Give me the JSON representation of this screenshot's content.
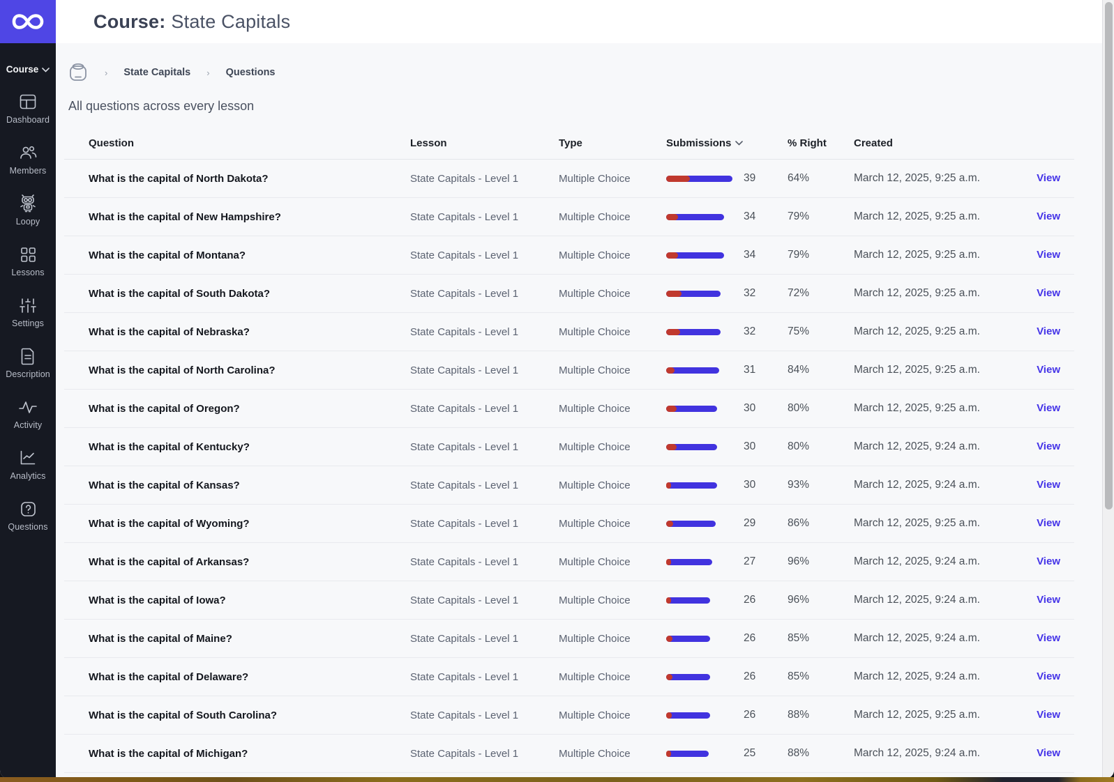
{
  "colors": {
    "accent": "#4f46e5",
    "sidebar_bg": "#161922",
    "bar_wrong_red": "#c0392e",
    "bar_right_blue": "#4133df",
    "link_blue": "#4433e8"
  },
  "sidebar": {
    "logo_icon": "infinity-icon",
    "course_switcher_label": "Course",
    "items": [
      {
        "label": "Dashboard",
        "icon": "dashboard-icon"
      },
      {
        "label": "Members",
        "icon": "members-icon"
      },
      {
        "label": "Loopy",
        "icon": "robot-icon"
      },
      {
        "label": "Lessons",
        "icon": "grid-icon"
      },
      {
        "label": "Settings",
        "icon": "sliders-icon"
      },
      {
        "label": "Description",
        "icon": "document-icon"
      },
      {
        "label": "Activity",
        "icon": "pulse-icon"
      },
      {
        "label": "Analytics",
        "icon": "chart-icon"
      },
      {
        "label": "Questions",
        "icon": "question-icon"
      }
    ]
  },
  "header": {
    "title_label": "Course:",
    "title_value": "State Capitals"
  },
  "breadcrumb": {
    "home_icon": "course-pot-icon",
    "items": [
      "State Capitals",
      "Questions"
    ]
  },
  "page": {
    "subtitle": "All questions across every lesson"
  },
  "table": {
    "columns": [
      "Question",
      "Lesson",
      "Type",
      "Submissions",
      "% Right",
      "Created"
    ],
    "sorted_column": "Submissions",
    "sort_direction": "desc",
    "action_label": "View",
    "max_submissions": 39,
    "rows": [
      {
        "question": "What is the capital of North Dakota?",
        "lesson": "State Capitals - Level 1",
        "type": "Multiple Choice",
        "submissions": 39,
        "right_pct": 64,
        "right_label": "64%",
        "created": "March 12, 2025, 9:25 a.m."
      },
      {
        "question": "What is the capital of New Hampshire?",
        "lesson": "State Capitals - Level 1",
        "type": "Multiple Choice",
        "submissions": 34,
        "right_pct": 79,
        "right_label": "79%",
        "created": "March 12, 2025, 9:25 a.m."
      },
      {
        "question": "What is the capital of Montana?",
        "lesson": "State Capitals - Level 1",
        "type": "Multiple Choice",
        "submissions": 34,
        "right_pct": 79,
        "right_label": "79%",
        "created": "March 12, 2025, 9:25 a.m."
      },
      {
        "question": "What is the capital of South Dakota?",
        "lesson": "State Capitals - Level 1",
        "type": "Multiple Choice",
        "submissions": 32,
        "right_pct": 72,
        "right_label": "72%",
        "created": "March 12, 2025, 9:25 a.m."
      },
      {
        "question": "What is the capital of Nebraska?",
        "lesson": "State Capitals - Level 1",
        "type": "Multiple Choice",
        "submissions": 32,
        "right_pct": 75,
        "right_label": "75%",
        "created": "March 12, 2025, 9:25 a.m."
      },
      {
        "question": "What is the capital of North Carolina?",
        "lesson": "State Capitals - Level 1",
        "type": "Multiple Choice",
        "submissions": 31,
        "right_pct": 84,
        "right_label": "84%",
        "created": "March 12, 2025, 9:25 a.m."
      },
      {
        "question": "What is the capital of Oregon?",
        "lesson": "State Capitals - Level 1",
        "type": "Multiple Choice",
        "submissions": 30,
        "right_pct": 80,
        "right_label": "80%",
        "created": "March 12, 2025, 9:25 a.m."
      },
      {
        "question": "What is the capital of Kentucky?",
        "lesson": "State Capitals - Level 1",
        "type": "Multiple Choice",
        "submissions": 30,
        "right_pct": 80,
        "right_label": "80%",
        "created": "March 12, 2025, 9:24 a.m."
      },
      {
        "question": "What is the capital of Kansas?",
        "lesson": "State Capitals - Level 1",
        "type": "Multiple Choice",
        "submissions": 30,
        "right_pct": 93,
        "right_label": "93%",
        "created": "March 12, 2025, 9:24 a.m."
      },
      {
        "question": "What is the capital of Wyoming?",
        "lesson": "State Capitals - Level 1",
        "type": "Multiple Choice",
        "submissions": 29,
        "right_pct": 86,
        "right_label": "86%",
        "created": "March 12, 2025, 9:25 a.m."
      },
      {
        "question": "What is the capital of Arkansas?",
        "lesson": "State Capitals - Level 1",
        "type": "Multiple Choice",
        "submissions": 27,
        "right_pct": 96,
        "right_label": "96%",
        "created": "March 12, 2025, 9:24 a.m."
      },
      {
        "question": "What is the capital of Iowa?",
        "lesson": "State Capitals - Level 1",
        "type": "Multiple Choice",
        "submissions": 26,
        "right_pct": 96,
        "right_label": "96%",
        "created": "March 12, 2025, 9:24 a.m."
      },
      {
        "question": "What is the capital of Maine?",
        "lesson": "State Capitals - Level 1",
        "type": "Multiple Choice",
        "submissions": 26,
        "right_pct": 85,
        "right_label": "85%",
        "created": "March 12, 2025, 9:24 a.m."
      },
      {
        "question": "What is the capital of Delaware?",
        "lesson": "State Capitals - Level 1",
        "type": "Multiple Choice",
        "submissions": 26,
        "right_pct": 85,
        "right_label": "85%",
        "created": "March 12, 2025, 9:24 a.m."
      },
      {
        "question": "What is the capital of South Carolina?",
        "lesson": "State Capitals - Level 1",
        "type": "Multiple Choice",
        "submissions": 26,
        "right_pct": 88,
        "right_label": "88%",
        "created": "March 12, 2025, 9:25 a.m."
      },
      {
        "question": "What is the capital of Michigan?",
        "lesson": "State Capitals - Level 1",
        "type": "Multiple Choice",
        "submissions": 25,
        "right_pct": 88,
        "right_label": "88%",
        "created": "March 12, 2025, 9:24 a.m."
      }
    ]
  }
}
